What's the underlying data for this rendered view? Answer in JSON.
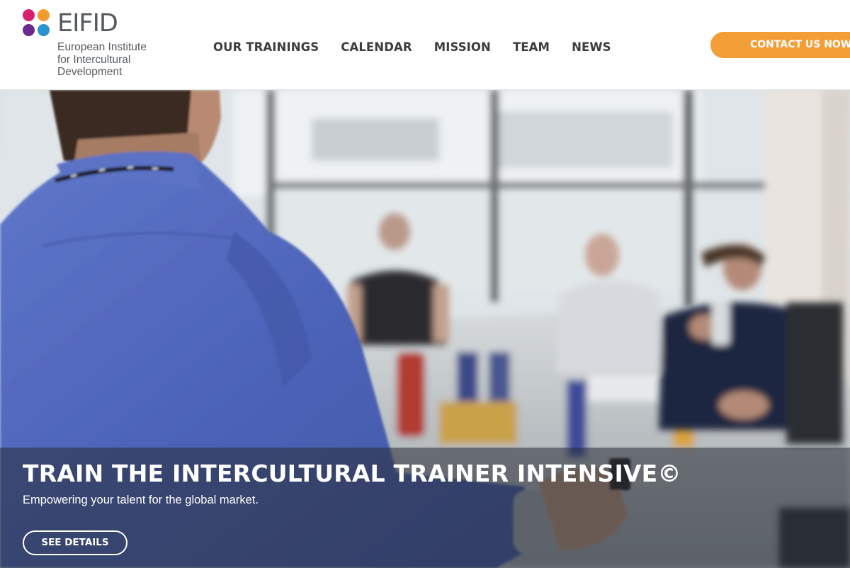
{
  "logo": {
    "wordmark": "EIFID",
    "subtitle_lines": [
      "European Institute",
      "for Intercultural",
      "Development"
    ],
    "dot_colors": [
      "#d6206e",
      "#f39a2a",
      "#6a2b8c",
      "#2a93cf"
    ]
  },
  "nav": {
    "items": [
      {
        "label": "OUR TRAININGS"
      },
      {
        "label": "CALENDAR"
      },
      {
        "label": "MISSION"
      },
      {
        "label": "TEAM"
      },
      {
        "label": "NEWS"
      }
    ]
  },
  "header": {
    "cta_label": "CONTACT US NOW!",
    "cta_color": "#f39d37"
  },
  "hero": {
    "title": "TRAIN THE INTERCULTURAL TRAINER INTENSIVE©",
    "subtitle": "Empowering your talent for the global market.",
    "button_label": "SEE DETAILS"
  }
}
